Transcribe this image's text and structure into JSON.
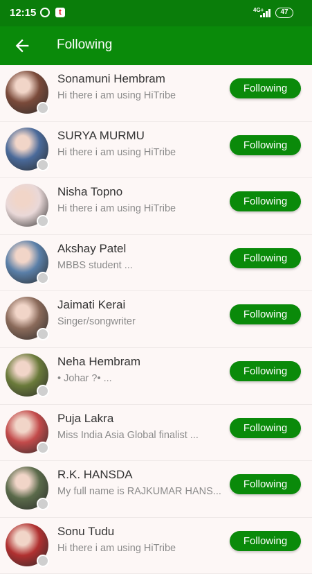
{
  "status_bar": {
    "time": "12:15",
    "network": "4G+",
    "battery": "47",
    "icons": [
      "whatsapp-icon",
      "app-notification-icon",
      "signal-icon",
      "battery-icon"
    ]
  },
  "header": {
    "title": "Following",
    "back_icon": "arrow-left-icon"
  },
  "colors": {
    "primary": "#0a8a0a",
    "status_bar": "#0a7d0a",
    "background": "#fdf7f6",
    "name_text": "#333333",
    "bio_text": "#8a8a8a"
  },
  "users": [
    {
      "name": "Sonamuni Hembram",
      "bio": "Hi there i am using HiTribe",
      "button": "Following",
      "avatar_color": "#7a4a3a"
    },
    {
      "name": "SURYA MURMU",
      "bio": "Hi there i am using HiTribe",
      "button": "Following",
      "avatar_color": "#4a6a9a"
    },
    {
      "name": "Nisha Topno",
      "bio": "Hi there i am using HiTribe",
      "button": "Following",
      "avatar_color": "#e9d8d8"
    },
    {
      "name": "Akshay Patel",
      "bio": "MBBS student  ...",
      "button": "Following",
      "avatar_color": "#5a7fa8"
    },
    {
      "name": "Jaimati Kerai",
      "bio": "Singer/songwriter",
      "button": "Following",
      "avatar_color": "#8a6a5a"
    },
    {
      "name": "Neha Hembram",
      "bio": "• Johar ?•     ...",
      "button": "Following",
      "avatar_color": "#6a7a3a"
    },
    {
      "name": "Puja Lakra",
      "bio": "Miss India Asia Global finalist  ...",
      "button": "Following",
      "avatar_color": "#c24a4a"
    },
    {
      "name": "R.K. HANSDA",
      "bio": "My full name is RAJKUMAR HANS...",
      "button": "Following",
      "avatar_color": "#5a6a4a"
    },
    {
      "name": "Sonu Tudu",
      "bio": "Hi there i am using HiTribe",
      "button": "Following",
      "avatar_color": "#b03030"
    }
  ]
}
